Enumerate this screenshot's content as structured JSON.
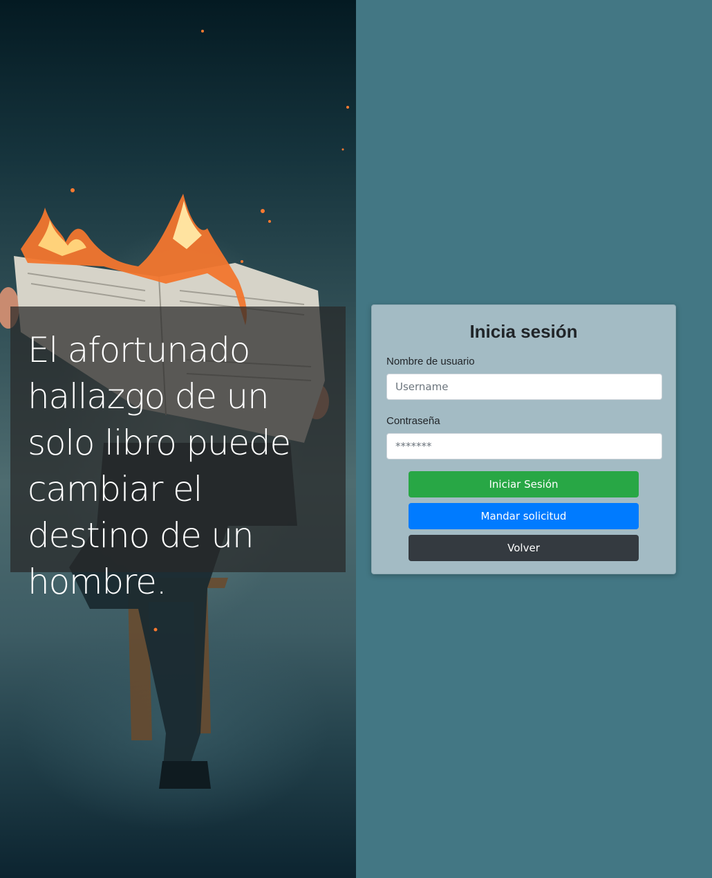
{
  "hero": {
    "quote": "El afortunado hallazgo de un solo libro puede cambiar el destino de un hombre.",
    "image": "person-reading-burning-newspaper"
  },
  "login": {
    "title": "Inicia sesión",
    "username_label": "Nombre de usuario",
    "username_placeholder": "Username",
    "username_value": "",
    "password_label": "Contraseña",
    "password_placeholder": "*******",
    "password_value": "",
    "login_button": "Iniciar Sesión",
    "request_button": "Mandar solicitud",
    "back_button": "Volver"
  },
  "colors": {
    "page_background": "#437784",
    "card_background": "#a3bbc4",
    "success": "#28a745",
    "primary": "#007bff",
    "dark": "#343a40"
  }
}
